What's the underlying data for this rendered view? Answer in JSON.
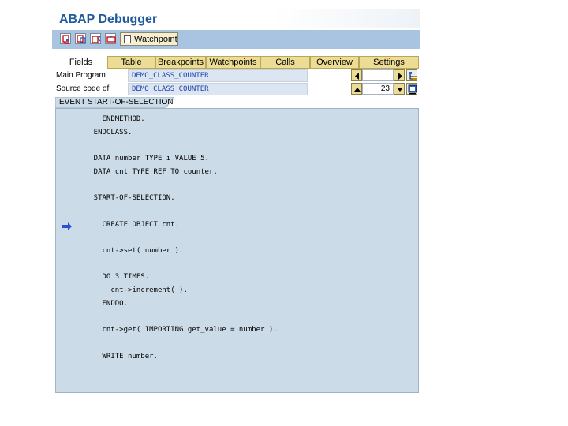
{
  "window": {
    "title": "ABAP Debugger"
  },
  "toolbar": {
    "buttons": [
      {
        "icon": "single-step-icon"
      },
      {
        "icon": "execute-icon"
      },
      {
        "icon": "return-icon"
      },
      {
        "icon": "continue-icon"
      }
    ],
    "watchpoint_label": "Watchpoint"
  },
  "tabs": [
    "Fields",
    "Table",
    "Breakpoints",
    "Watchpoints",
    "Calls",
    "Overview",
    "Settings"
  ],
  "main_program": {
    "label": "Main Program",
    "value": "DEMO_CLASS_COUNTER",
    "line": ""
  },
  "source_code": {
    "label": "Source code of",
    "value": "DEMO_CLASS_COUNTER",
    "line": "23"
  },
  "section": {
    "label": "EVENT START-OF-SELECTION"
  },
  "code_lines": [
    "      ENDMETHOD.",
    "    ENDCLASS.",
    "",
    "    DATA number TYPE i VALUE 5.",
    "    DATA cnt TYPE REF TO counter.",
    "",
    "    START-OF-SELECTION.",
    "",
    "      CREATE OBJECT cnt.",
    "",
    "      cnt->set( number ).",
    "",
    "      DO 3 TIMES.",
    "        cnt->increment( ).",
    "      ENDDO.",
    "",
    "      cnt->get( IMPORTING get_value = number ).",
    "",
    "      WRITE number."
  ],
  "current_line_index": 8,
  "colors": {
    "accent": "#1f5a9c",
    "toolbar": "#a9c4e0",
    "tab": "#ecdc94",
    "code_bg": "#ccdbe8",
    "arrow": "#2f4fd0"
  }
}
